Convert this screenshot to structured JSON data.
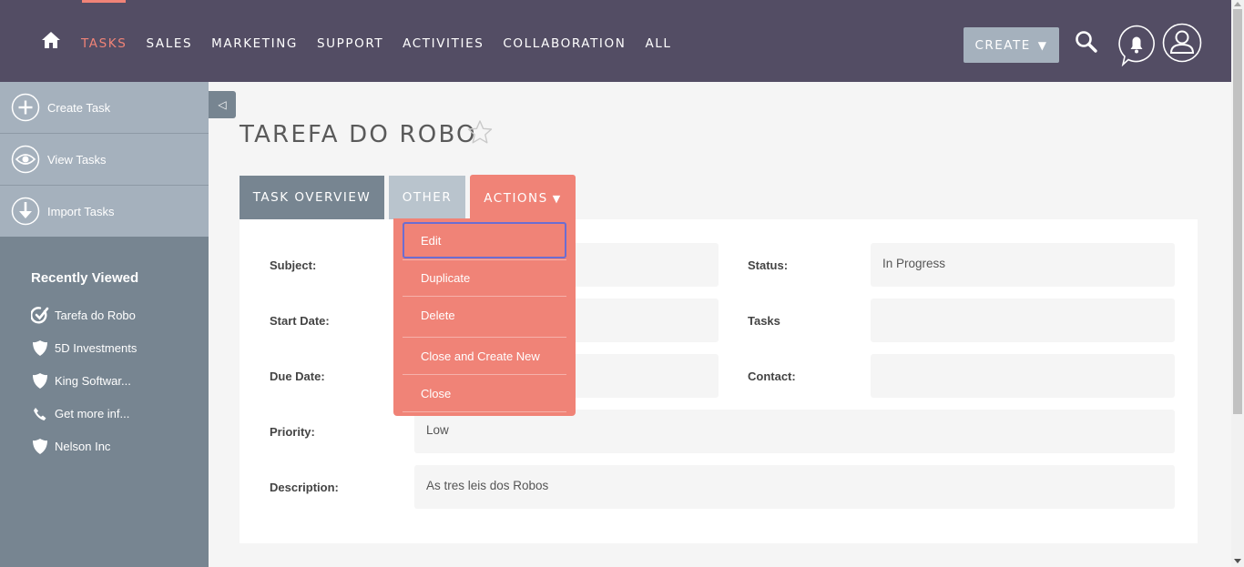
{
  "nav": {
    "items": [
      "TASKS",
      "SALES",
      "MARKETING",
      "SUPPORT",
      "ACTIVITIES",
      "COLLABORATION",
      "ALL"
    ],
    "active_index": 0,
    "create_label": "CREATE",
    "icons": [
      "home-icon",
      "search-icon",
      "bell-icon",
      "user-icon"
    ]
  },
  "sidebar": {
    "actions": [
      {
        "label": "Create Task",
        "icon": "plus-circle-icon"
      },
      {
        "label": "View Tasks",
        "icon": "eye-icon"
      },
      {
        "label": "Import Tasks",
        "icon": "download-icon"
      }
    ],
    "recent_title": "Recently Viewed",
    "recent": [
      {
        "label": "Tarefa do Robo",
        "icon": "task-icon"
      },
      {
        "label": "5D Investments",
        "icon": "shield-icon"
      },
      {
        "label": "King Softwar...",
        "icon": "shield-icon"
      },
      {
        "label": "Get more inf...",
        "icon": "phone-icon"
      },
      {
        "label": "Nelson Inc",
        "icon": "shield-icon"
      }
    ]
  },
  "page": {
    "title": "TAREFA DO ROBO"
  },
  "tabs": {
    "overview": "TASK OVERVIEW",
    "other": "OTHER",
    "actions": "ACTIONS"
  },
  "actions_menu": [
    "Edit",
    "Duplicate",
    "Delete",
    "Close and Create New",
    "Close"
  ],
  "fields": {
    "subject_label": "Subject:",
    "subject_value": "",
    "status_label": "Status:",
    "status_value": "In Progress",
    "start_date_label": "Start Date:",
    "start_date_value": "",
    "tasks_label": "Tasks",
    "tasks_value": "",
    "due_date_label": "Due Date:",
    "due_date_value": "",
    "contact_label": "Contact:",
    "contact_value": "",
    "priority_label": "Priority:",
    "priority_value": "Low",
    "description_label": "Description:",
    "description_value": "As tres leis dos Robos"
  },
  "colors": {
    "navbar": "#534d64",
    "accent": "#f08377",
    "sidebar": "#778591",
    "sidebar_actions": "#a5b1bd"
  }
}
